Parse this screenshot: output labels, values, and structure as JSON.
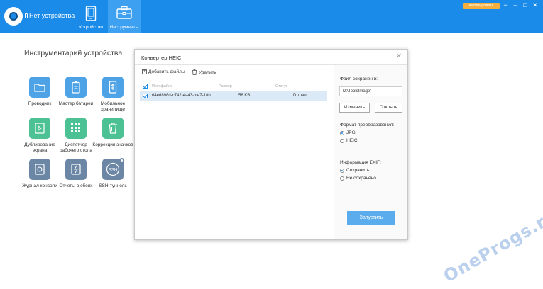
{
  "header": {
    "device_status": "Нет устройства",
    "tabs": [
      {
        "label": "Устройство",
        "icon": "phone-icon"
      },
      {
        "label": "Инструменты",
        "icon": "toolbox-icon"
      }
    ],
    "activate_label": "Активировать",
    "window_buttons": [
      "≡",
      "–",
      "□",
      "✕"
    ]
  },
  "tools": {
    "title": "Инструментарий устройства",
    "items": [
      {
        "label": "Проводник",
        "icon": "folder-icon",
        "color": "#4ea3e6"
      },
      {
        "label": "Мастер батареи",
        "icon": "battery-icon",
        "color": "#4ea3e6"
      },
      {
        "label": "Мобильное хранилище",
        "icon": "usb-icon",
        "color": "#4ea3e6"
      },
      {
        "label": "Дублирование экрана",
        "icon": "screen-mirror-icon",
        "color": "#4cc193"
      },
      {
        "label": "Диспетчер рабочего стола",
        "icon": "desktop-grid-icon",
        "color": "#4cc193"
      },
      {
        "label": "Коррекция значков",
        "icon": "trash-icon",
        "color": "#4cc193"
      },
      {
        "label": "Журнал консоли",
        "icon": "console-log-icon",
        "color": "#6c86a5"
      },
      {
        "label": "Отчеты о сбоях",
        "icon": "crash-report-icon",
        "color": "#6c86a5"
      },
      {
        "label": "SSH-туннель",
        "icon": "ssh-icon",
        "color": "#6c86a5"
      }
    ]
  },
  "dialog": {
    "title": "Конвертер HEIC",
    "toolbar": {
      "add_label": "Добавить файлы",
      "delete_label": "Удалить"
    },
    "columns": [
      "Имя файла",
      "Размер",
      "Статус"
    ],
    "files": [
      {
        "name": "64ed898d-c742-4a43-bfe7-18b...",
        "size": "56 KB",
        "status": "Готово",
        "checked": true
      }
    ],
    "saved_label": "Файл сохранен в:",
    "save_path": "D:\\ToolsImage\\",
    "change_label": "Изменить",
    "open_label": "Открыть",
    "format_label": "Формат преобразования:",
    "formats": [
      {
        "label": "JPG",
        "selected": true
      },
      {
        "label": "HEIC",
        "selected": false
      }
    ],
    "exif_label": "Информация EXIF:",
    "exif_options": [
      {
        "label": "Сохранить",
        "selected": true
      },
      {
        "label": "Не сохранено",
        "selected": false
      }
    ],
    "run_label": "Запустить"
  },
  "watermark": "OneProgs.ru"
}
